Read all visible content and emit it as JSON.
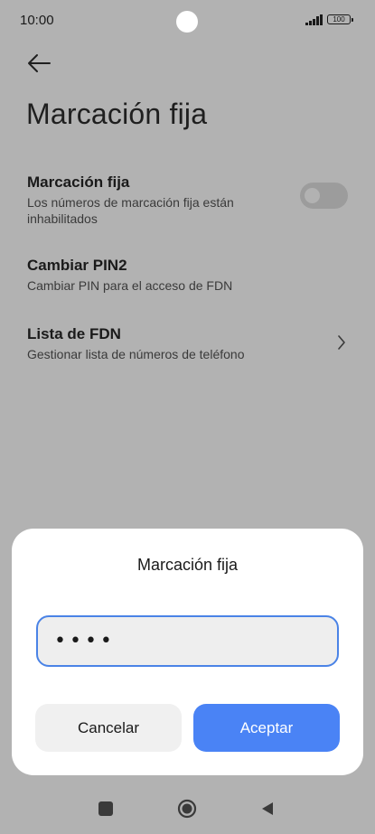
{
  "status_bar": {
    "time": "10:00",
    "battery": "100"
  },
  "page": {
    "title": "Marcación fija"
  },
  "settings": [
    {
      "title": "Marcación fija",
      "subtitle": "Los números de marcación fija están inhabilitados",
      "control": "toggle",
      "enabled": false
    },
    {
      "title": "Cambiar PIN2",
      "subtitle": "Cambiar PIN para el acceso de FDN",
      "control": "none"
    },
    {
      "title": "Lista de FDN",
      "subtitle": "Gestionar lista de números de teléfono",
      "control": "chevron"
    }
  ],
  "dialog": {
    "title": "Marcación fija",
    "pin_value": "••••",
    "cancel_label": "Cancelar",
    "accept_label": "Aceptar"
  },
  "colors": {
    "accent": "#4a83f5",
    "input_border": "#4a83e6",
    "dimmed_background": "#b2b2b2"
  },
  "icons": {
    "back": "arrow-left-icon",
    "chevron": "chevron-right-icon",
    "nav_recent": "square-icon",
    "nav_home": "circle-icon",
    "nav_back": "triangle-back-icon"
  }
}
